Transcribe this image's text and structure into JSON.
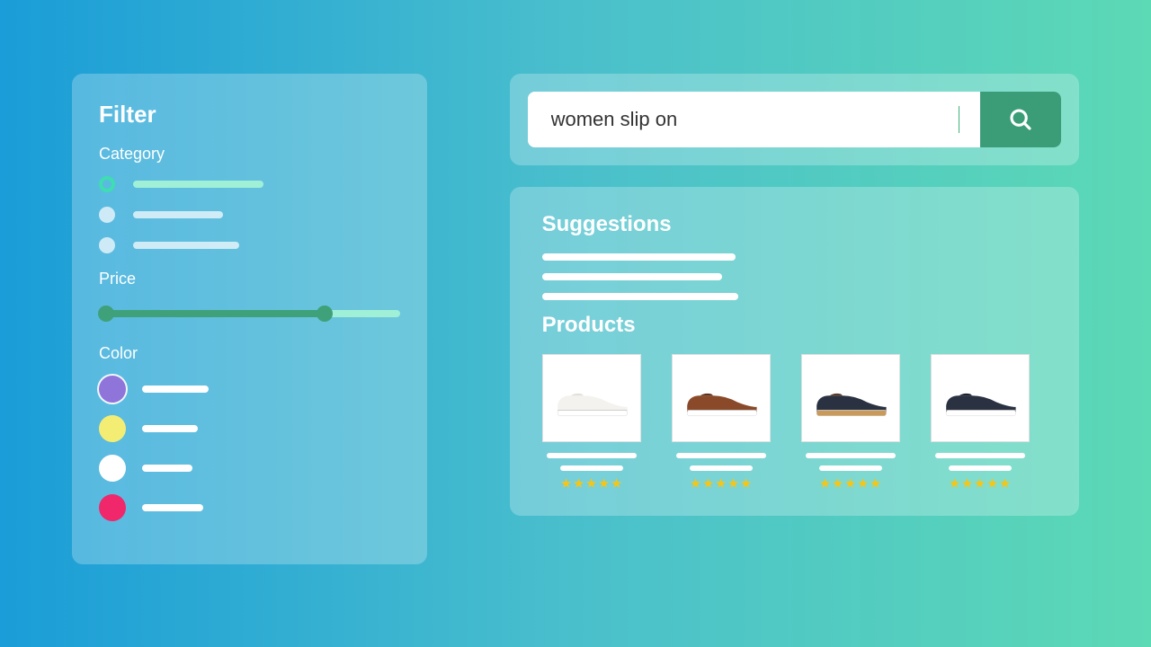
{
  "filter": {
    "title": "Filter",
    "category": {
      "label": "Category",
      "items": [
        {
          "selected": true,
          "width": 145
        },
        {
          "selected": false,
          "width": 100
        },
        {
          "selected": false,
          "width": 118
        }
      ]
    },
    "price": {
      "label": "Price",
      "min_pct": 0,
      "max_pct": 75
    },
    "color": {
      "label": "Color",
      "options": [
        {
          "name": "purple",
          "hex": "#8f74d9",
          "ring": true,
          "line_width": 74
        },
        {
          "name": "yellow",
          "hex": "#f4ed74",
          "ring": false,
          "line_width": 62
        },
        {
          "name": "white",
          "hex": "#ffffff",
          "ring": false,
          "line_width": 56
        },
        {
          "name": "pink",
          "hex": "#f0276b",
          "ring": false,
          "line_width": 68
        }
      ]
    }
  },
  "search": {
    "value": "women slip on",
    "placeholder": "Search"
  },
  "suggestions": {
    "title": "Suggestions",
    "lines": [
      215,
      200,
      218
    ]
  },
  "products": {
    "title": "Products",
    "items": [
      {
        "id": "shoe-white",
        "rating": 5,
        "upper": "#f3f2ee",
        "sole": "#ffffff",
        "accent": "#e2e0d8"
      },
      {
        "id": "shoe-brown",
        "rating": 5,
        "upper": "#8a4a2a",
        "sole": "#ffffff",
        "accent": "#5f311b"
      },
      {
        "id": "shoe-navy-gum",
        "rating": 5,
        "upper": "#2a3140",
        "sole": "#c99a5a",
        "accent": "#5a3a28"
      },
      {
        "id": "shoe-navy-white",
        "rating": 5,
        "upper": "#2a3140",
        "sole": "#ffffff",
        "accent": "#1c222e"
      }
    ]
  },
  "colors": {
    "accent": "#3fa17a",
    "search_btn": "#3a9d77"
  }
}
